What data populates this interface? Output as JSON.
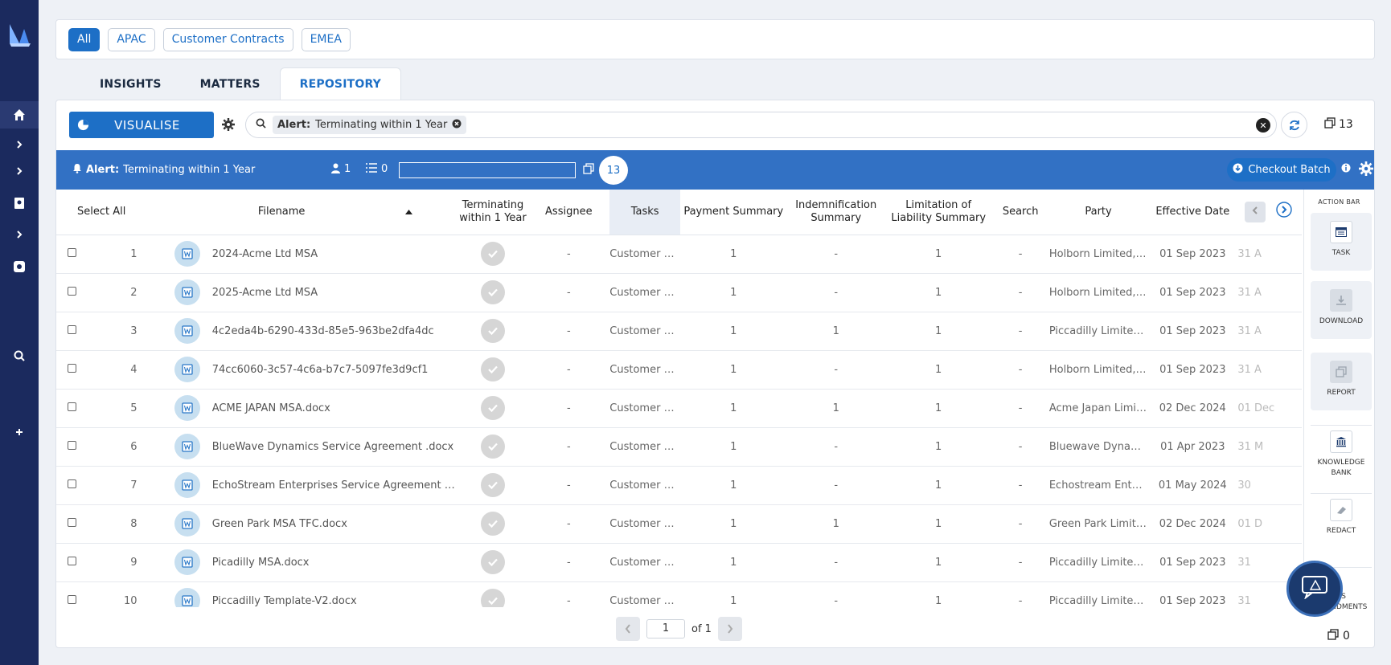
{
  "chips": [
    "All",
    "APAC",
    "Customer Contracts",
    "EMEA"
  ],
  "tabs": [
    "INSIGHTS",
    "MATTERS",
    "REPOSITORY"
  ],
  "toolbar": {
    "visualise_label": "VISUALISE",
    "search_tag_key": "Alert:",
    "search_tag_value": "Terminating within 1 Year",
    "doc_count": "13"
  },
  "alert_bar": {
    "alert_key": "Alert:",
    "alert_value": "Terminating within 1 Year",
    "people_count": "1",
    "task_count": "0",
    "bubble_count": "13",
    "checkout_label": "Checkout Batch"
  },
  "table": {
    "select_all": "Select All",
    "headers": {
      "filename": "Filename",
      "terminating": "Terminating within 1 Year",
      "assignee": "Assignee",
      "tasks": "Tasks",
      "payment": "Payment Summary",
      "indemnification": "Indemnification Summary",
      "limitation": "Limitation of Liability Summary",
      "search": "Search",
      "party": "Party",
      "effective": "Effective Date"
    },
    "rows": [
      {
        "num": "1",
        "filename": "2024-Acme Ltd MSA",
        "assignee": "-",
        "tasks": "Customer C...",
        "payment": "1",
        "indemn": "-",
        "limit": "1",
        "search": "-",
        "party": "Holborn Limited, ...",
        "effective": "01 Sep 2023",
        "next": "31 A"
      },
      {
        "num": "2",
        "filename": "2025-Acme Ltd MSA",
        "assignee": "-",
        "tasks": "Customer C...",
        "payment": "1",
        "indemn": "-",
        "limit": "1",
        "search": "-",
        "party": "Holborn Limited, ...",
        "effective": "01 Sep 2023",
        "next": "31 A"
      },
      {
        "num": "3",
        "filename": "4c2eda4b-6290-433d-85e5-963be2dfa4dc",
        "assignee": "-",
        "tasks": "Customer C...",
        "payment": "1",
        "indemn": "1",
        "limit": "1",
        "search": "-",
        "party": "Piccadilly Limited, ...",
        "effective": "01 Sep 2023",
        "next": "31 A"
      },
      {
        "num": "4",
        "filename": "74cc6060-3c57-4c6a-b7c7-5097fe3d9cf1",
        "assignee": "-",
        "tasks": "Customer C...",
        "payment": "1",
        "indemn": "-",
        "limit": "1",
        "search": "-",
        "party": "Holborn Limited, ...",
        "effective": "01 Sep 2023",
        "next": "31 A"
      },
      {
        "num": "5",
        "filename": "ACME JAPAN MSA.docx",
        "assignee": "-",
        "tasks": "Customer C...",
        "payment": "1",
        "indemn": "1",
        "limit": "1",
        "search": "-",
        "party": "Acme Japan Limite...",
        "effective": "02 Dec 2024",
        "next": "01 Dec"
      },
      {
        "num": "6",
        "filename": "BlueWave Dynamics Service Agreement .docx",
        "assignee": "-",
        "tasks": "Customer C...",
        "payment": "1",
        "indemn": "-",
        "limit": "1",
        "search": "-",
        "party": "Bluewave Dynamic...",
        "effective": "01 Apr 2023",
        "next": "31 M"
      },
      {
        "num": "7",
        "filename": "EchoStream Enterprises Service Agreement .docx",
        "assignee": "-",
        "tasks": "Customer C...",
        "payment": "1",
        "indemn": "-",
        "limit": "1",
        "search": "-",
        "party": "Echostream Enterp...",
        "effective": "01 May 2024",
        "next": "30"
      },
      {
        "num": "8",
        "filename": "Green Park MSA TFC.docx",
        "assignee": "-",
        "tasks": "Customer C...",
        "payment": "1",
        "indemn": "1",
        "limit": "1",
        "search": "-",
        "party": "Green Park Limite...",
        "effective": "02 Dec 2024",
        "next": "01 D"
      },
      {
        "num": "9",
        "filename": "Picadilly MSA.docx",
        "assignee": "-",
        "tasks": "Customer C...",
        "payment": "1",
        "indemn": "-",
        "limit": "1",
        "search": "-",
        "party": "Piccadilly Limited, ...",
        "effective": "01 Sep 2023",
        "next": "31"
      },
      {
        "num": "10",
        "filename": "Piccadilly Template-V2.docx",
        "assignee": "-",
        "tasks": "Customer C...",
        "payment": "1",
        "indemn": "-",
        "limit": "1",
        "search": "-",
        "party": "Piccadilly Limited, ...",
        "effective": "01 Sep 2023",
        "next": "31"
      }
    ]
  },
  "action_bar": {
    "title": "ACTION BAR",
    "items": [
      "TASK",
      "DOWNLOAD",
      "REPORT",
      "KNOWLEDGE BANK",
      "REDACT",
      "AS AMENDMENTS"
    ],
    "bottom_count": "0"
  },
  "pager": {
    "page": "1",
    "of": "of 1"
  },
  "colors": {
    "primary": "#1d6fc6",
    "nav": "#1b2a5e",
    "alert_bar": "#3271c4"
  }
}
